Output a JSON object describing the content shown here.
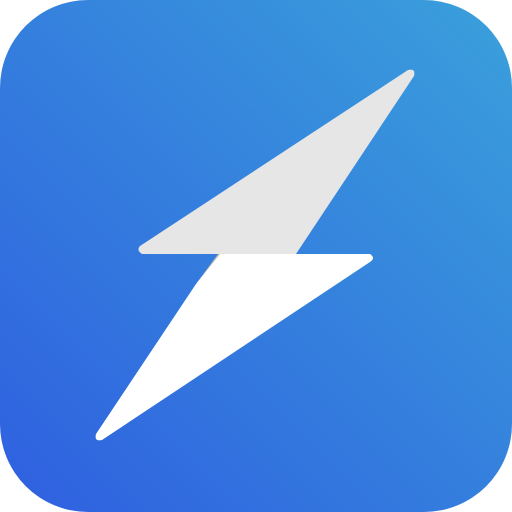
{
  "icon": {
    "semantic": "lightning-bolt-icon",
    "colors": {
      "gradient_start": "#2F5FE0",
      "gradient_end": "#3AA0DB",
      "bolt_top": "#E6E6E6",
      "bolt_bottom": "#FFFFFF",
      "bolt_shadow": "#B8B8B8"
    }
  }
}
